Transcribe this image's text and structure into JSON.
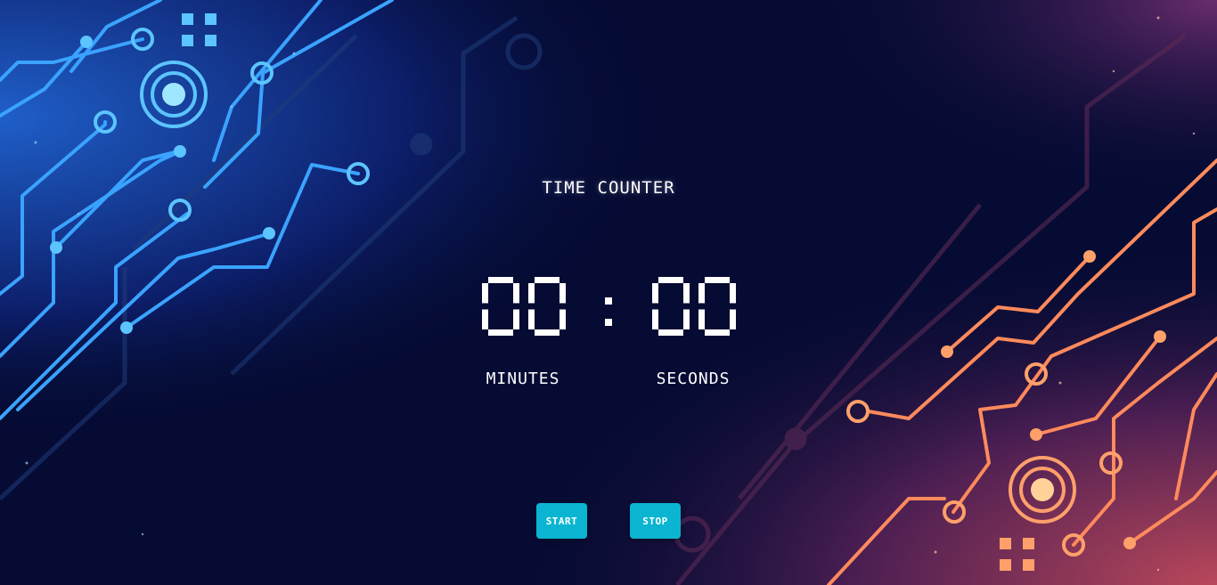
{
  "timer": {
    "title": "TIME COUNTER",
    "minutes": "00",
    "seconds": "00",
    "separator": ":",
    "minutes_label": "MINUTES",
    "seconds_label": "SECONDS"
  },
  "controls": {
    "start_label": "START",
    "stop_label": "STOP"
  },
  "colors": {
    "background": "#050b33",
    "circuit_left": "#3aa3ff",
    "circuit_right": "#ff8a5c",
    "button": "#0bb5d1",
    "text": "#ffffff"
  }
}
